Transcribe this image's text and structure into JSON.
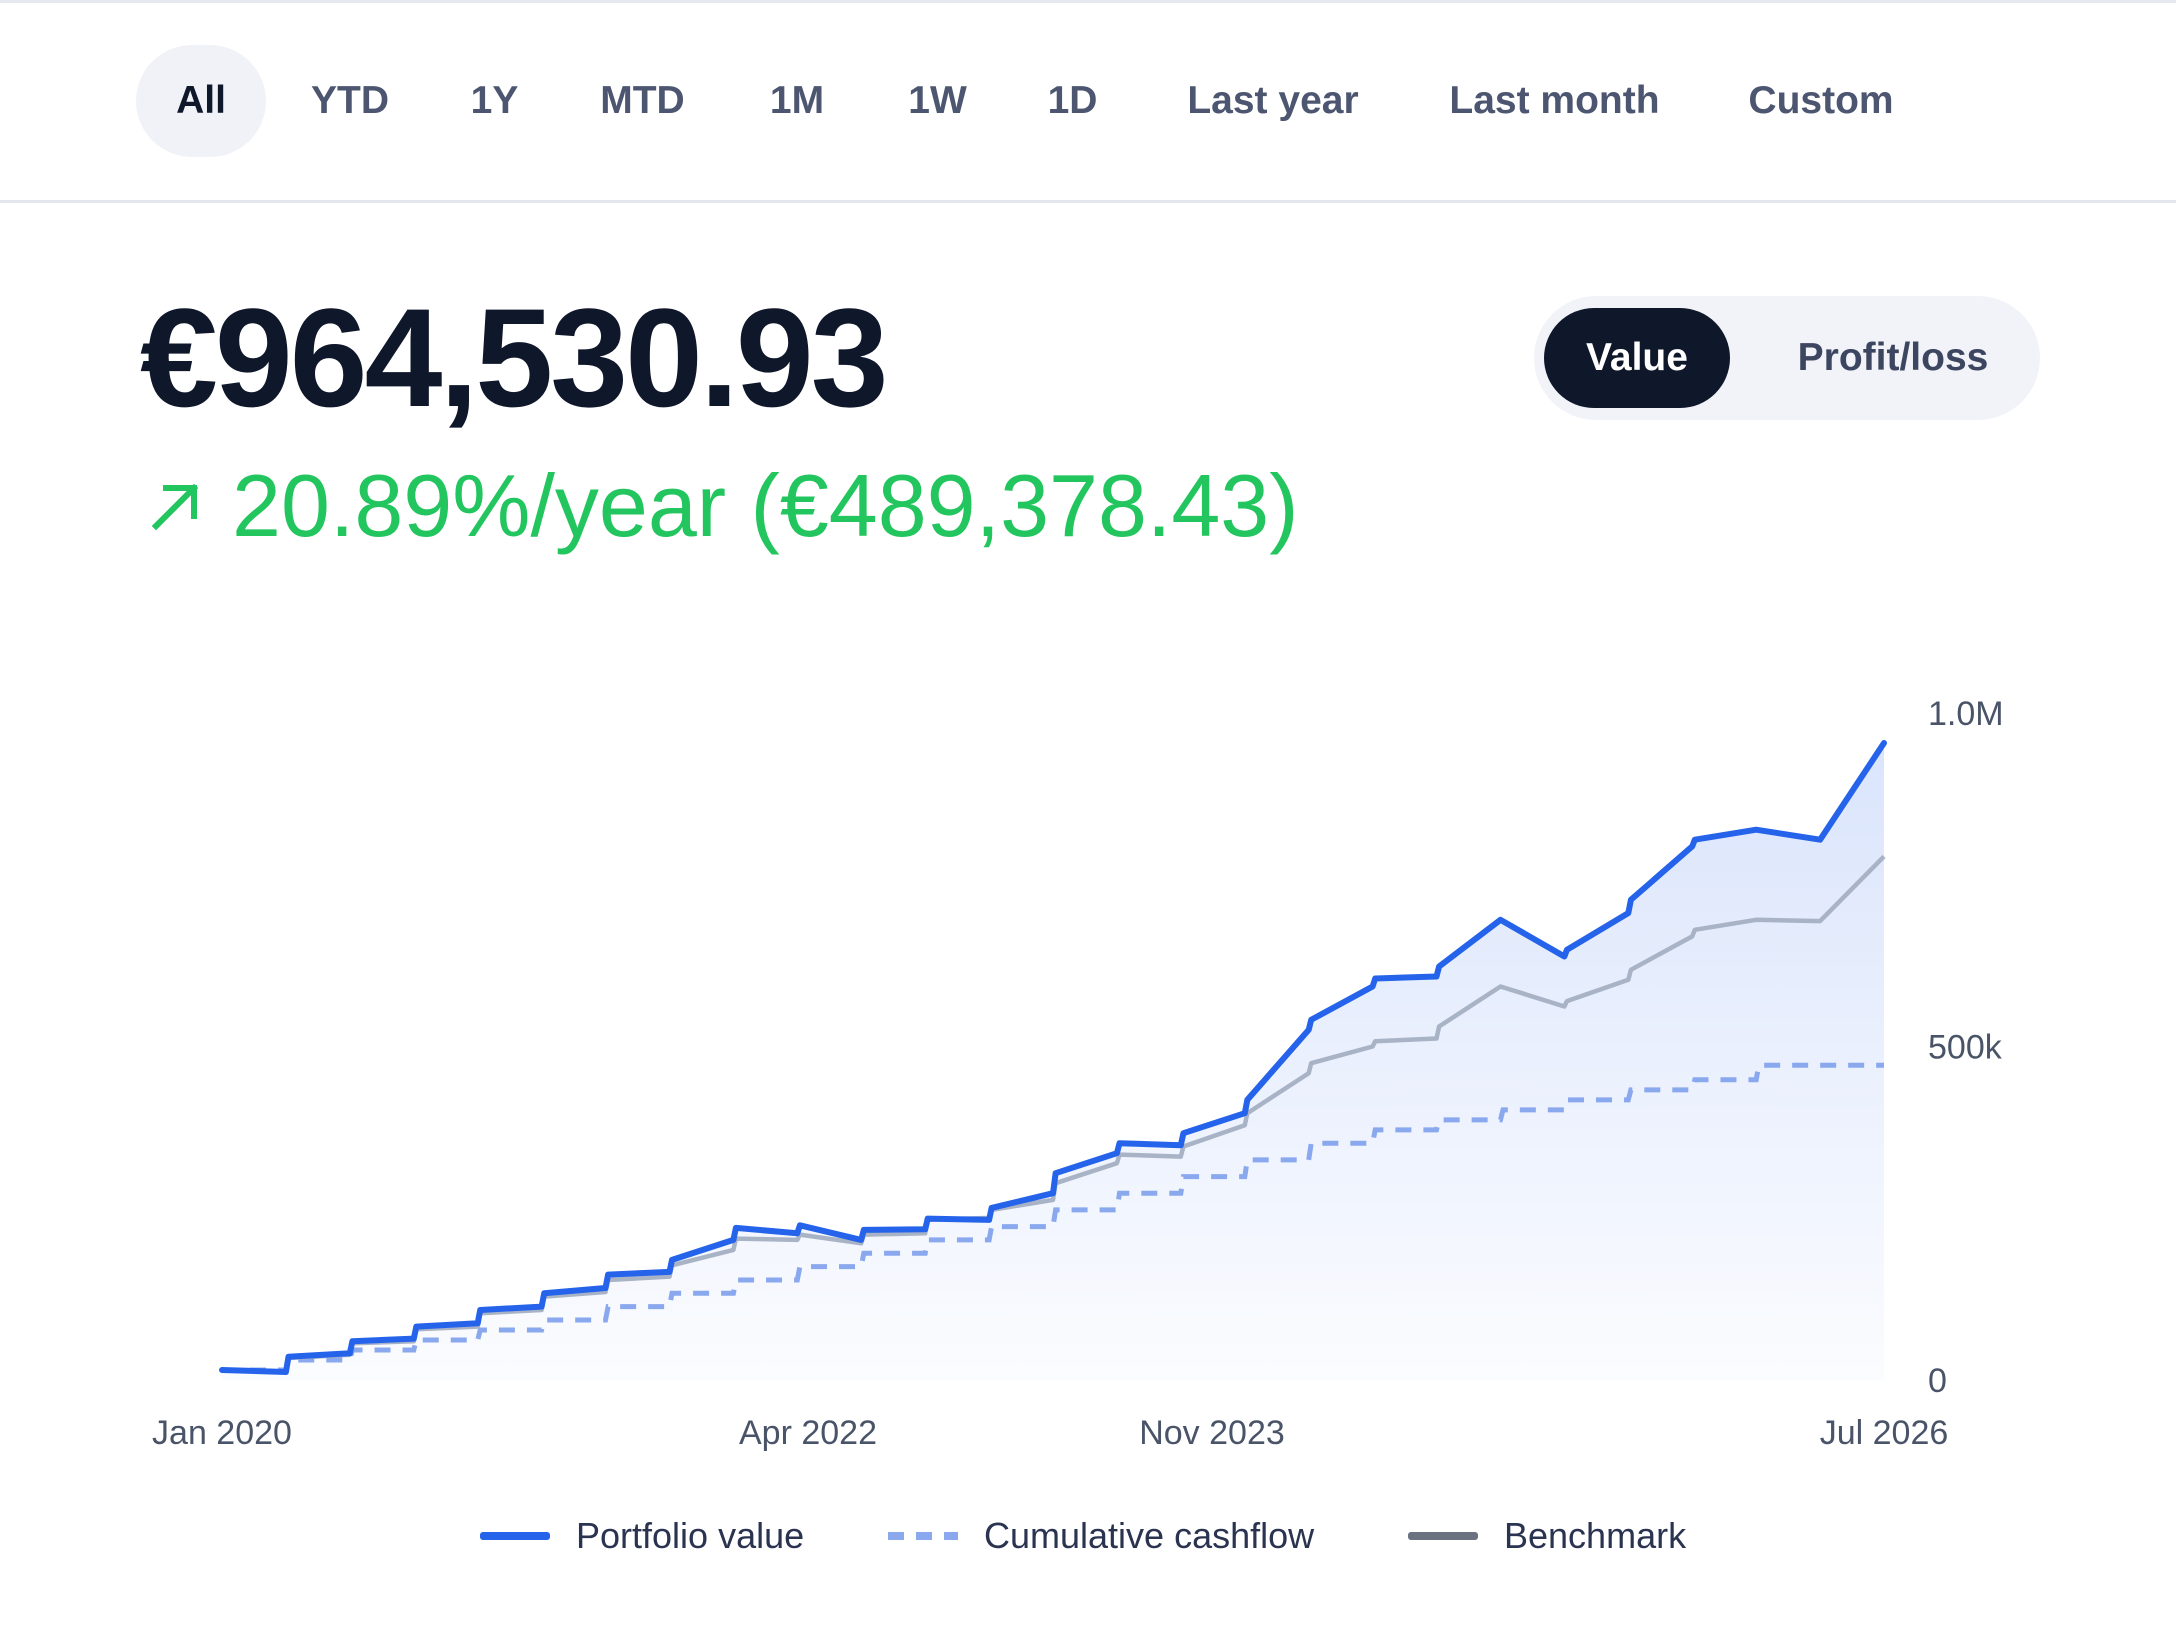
{
  "tabs": [
    {
      "label": "All",
      "active": true
    },
    {
      "label": "YTD",
      "active": false
    },
    {
      "label": "1Y",
      "active": false
    },
    {
      "label": "MTD",
      "active": false
    },
    {
      "label": "1M",
      "active": false
    },
    {
      "label": "1W",
      "active": false
    },
    {
      "label": "1D",
      "active": false
    },
    {
      "label": "Last year",
      "active": false
    },
    {
      "label": "Last month",
      "active": false
    },
    {
      "label": "Custom",
      "active": false
    }
  ],
  "summary": {
    "value": "€964,530.93",
    "return_text": "20.89%/year (€489,378.43)",
    "trend_icon": "arrow-up-right-icon"
  },
  "view_toggle": {
    "options": [
      "Value",
      "Profit/loss"
    ],
    "selected": "Value"
  },
  "colors": {
    "portfolio": "#2563eb",
    "cashflow": "#8aa8ee",
    "benchmark": "#a9b3c6",
    "legend_benchmark": "#6b7280",
    "positive": "#22c55e",
    "ink": "#0f172a"
  },
  "chart_data": {
    "type": "line",
    "x_tick_labels": [
      "Jan 2020",
      "Apr 2022",
      "Nov 2023",
      "Jul 2026"
    ],
    "y_tick_labels": [
      "1.0M",
      "500k",
      "0"
    ],
    "ylim": [
      0,
      1000000
    ],
    "xlim": [
      2020.0,
      2026.5
    ],
    "grid": false,
    "legend_position": "bottom",
    "area_fill_under": "Portfolio value",
    "series": [
      {
        "name": "Portfolio value",
        "style": "solid",
        "x": [
          2020.0,
          2020.25,
          2020.26,
          2020.5,
          2020.51,
          2020.75,
          2020.76,
          2021.0,
          2021.01,
          2021.25,
          2021.26,
          2021.5,
          2021.51,
          2021.75,
          2021.76,
          2022.0,
          2022.01,
          2022.25,
          2022.26,
          2022.5,
          2022.51,
          2022.75,
          2022.76,
          2023.0,
          2023.01,
          2023.25,
          2023.26,
          2023.5,
          2023.51,
          2023.75,
          2023.76,
          2024.0,
          2024.01,
          2024.25,
          2024.26,
          2024.5,
          2024.51,
          2024.75,
          2024.76,
          2025.0,
          2025.25,
          2025.26,
          2025.5,
          2025.51,
          2025.75,
          2025.76,
          2026.0,
          2026.25,
          2026.5
        ],
        "y": [
          15000,
          12000,
          35000,
          40000,
          58000,
          62000,
          80000,
          85000,
          105000,
          110000,
          130000,
          138000,
          158000,
          162000,
          180000,
          210000,
          228000,
          220000,
          232000,
          210000,
          225000,
          226000,
          242000,
          240000,
          258000,
          280000,
          310000,
          340000,
          355000,
          352000,
          370000,
          400000,
          420000,
          525000,
          540000,
          590000,
          602000,
          605000,
          620000,
          690000,
          635000,
          645000,
          700000,
          720000,
          800000,
          810000,
          825000,
          810000,
          955000
        ]
      },
      {
        "name": "Cumulative cashflow",
        "style": "dashed",
        "x": [
          2020.0,
          2020.25,
          2020.26,
          2020.5,
          2020.51,
          2020.75,
          2020.76,
          2021.0,
          2021.01,
          2021.25,
          2021.26,
          2021.5,
          2021.51,
          2021.75,
          2021.76,
          2022.0,
          2022.01,
          2022.25,
          2022.26,
          2022.5,
          2022.51,
          2022.75,
          2022.76,
          2023.0,
          2023.01,
          2023.25,
          2023.26,
          2023.5,
          2023.51,
          2023.75,
          2023.76,
          2024.0,
          2024.01,
          2024.25,
          2024.26,
          2024.5,
          2024.51,
          2024.75,
          2024.76,
          2025.0,
          2025.01,
          2025.25,
          2025.26,
          2025.5,
          2025.51,
          2025.75,
          2025.76,
          2026.0,
          2026.01,
          2026.5
        ],
        "y": [
          15000,
          15000,
          30000,
          30000,
          45000,
          45000,
          60000,
          60000,
          75000,
          75000,
          90000,
          90000,
          110000,
          110000,
          130000,
          130000,
          150000,
          150000,
          170000,
          170000,
          190000,
          190000,
          210000,
          210000,
          230000,
          230000,
          255000,
          255000,
          280000,
          280000,
          305000,
          305000,
          330000,
          330000,
          355000,
          355000,
          375000,
          375000,
          390000,
          390000,
          405000,
          405000,
          420000,
          420000,
          435000,
          435000,
          450000,
          450000,
          472000,
          472000
        ]
      },
      {
        "name": "Benchmark",
        "style": "solid",
        "x": [
          2020.0,
          2020.25,
          2020.26,
          2020.5,
          2020.51,
          2020.75,
          2020.76,
          2021.0,
          2021.01,
          2021.25,
          2021.26,
          2021.5,
          2021.51,
          2021.75,
          2021.76,
          2022.0,
          2022.01,
          2022.25,
          2022.26,
          2022.5,
          2022.51,
          2022.75,
          2022.76,
          2023.0,
          2023.01,
          2023.25,
          2023.26,
          2023.5,
          2023.51,
          2023.75,
          2023.76,
          2024.0,
          2024.01,
          2024.25,
          2024.26,
          2024.5,
          2024.51,
          2024.75,
          2024.76,
          2025.0,
          2025.25,
          2025.26,
          2025.5,
          2025.51,
          2025.75,
          2025.76,
          2026.0,
          2026.25,
          2026.5
        ],
        "y": [
          15000,
          12000,
          33000,
          38000,
          55000,
          58000,
          76000,
          80000,
          100000,
          105000,
          125000,
          132000,
          150000,
          155000,
          172000,
          195000,
          212000,
          210000,
          218000,
          205000,
          218000,
          220000,
          240000,
          243000,
          255000,
          270000,
          295000,
          325000,
          338000,
          335000,
          350000,
          382000,
          400000,
          460000,
          475000,
          500000,
          508000,
          512000,
          530000,
          590000,
          560000,
          568000,
          600000,
          615000,
          665000,
          675000,
          690000,
          688000,
          785000
        ]
      }
    ]
  }
}
